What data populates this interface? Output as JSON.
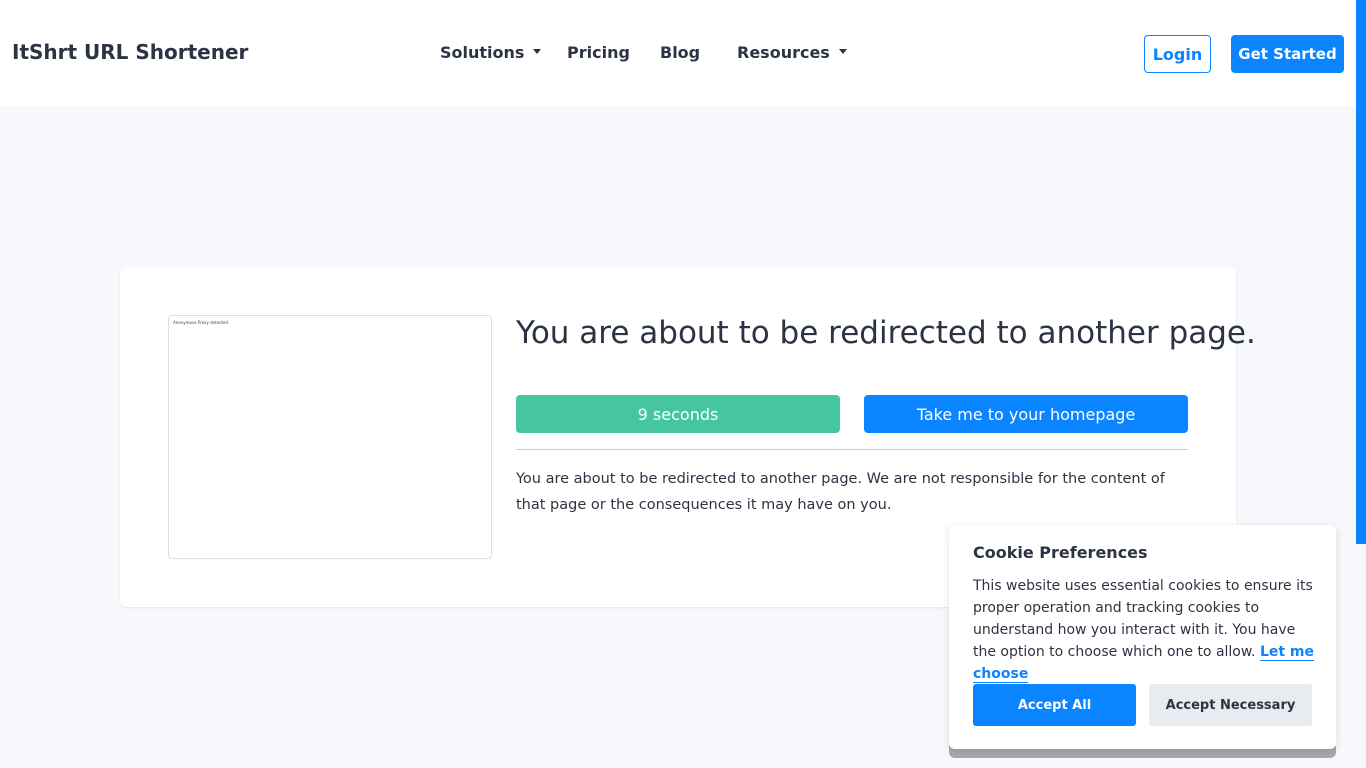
{
  "header": {
    "brand": "ItShrt URL Shortener",
    "nav": [
      {
        "label": "Solutions",
        "has_dropdown": true
      },
      {
        "label": "Pricing",
        "has_dropdown": false
      },
      {
        "label": "Blog",
        "has_dropdown": false
      },
      {
        "label": "Resources",
        "has_dropdown": true
      }
    ],
    "login_label": "Login",
    "get_started_label": "Get Started"
  },
  "main": {
    "preview_text": "Anonymous Proxy detected.",
    "heading": "You are about to be redirected to another page.",
    "countdown_label": "9 seconds",
    "homepage_button_label": "Take me to your homepage",
    "disclaimer": "You are about to be redirected to another page. We are not responsible for the content of that page or the consequences it may have on you."
  },
  "cookie": {
    "title": "Cookie Preferences",
    "text": "This website uses essential cookies to ensure its proper operation and tracking cookies to understand how you interact with it. You have the option to choose which one to allow.",
    "choose_link": "Let me choose",
    "accept_all_label": "Accept All",
    "accept_necessary_label": "Accept Necessary"
  },
  "colors": {
    "accent": "#0a84ff",
    "countdown": "#45c6a0",
    "text": "#2c3444",
    "page_bg": "#f6f8fb"
  }
}
